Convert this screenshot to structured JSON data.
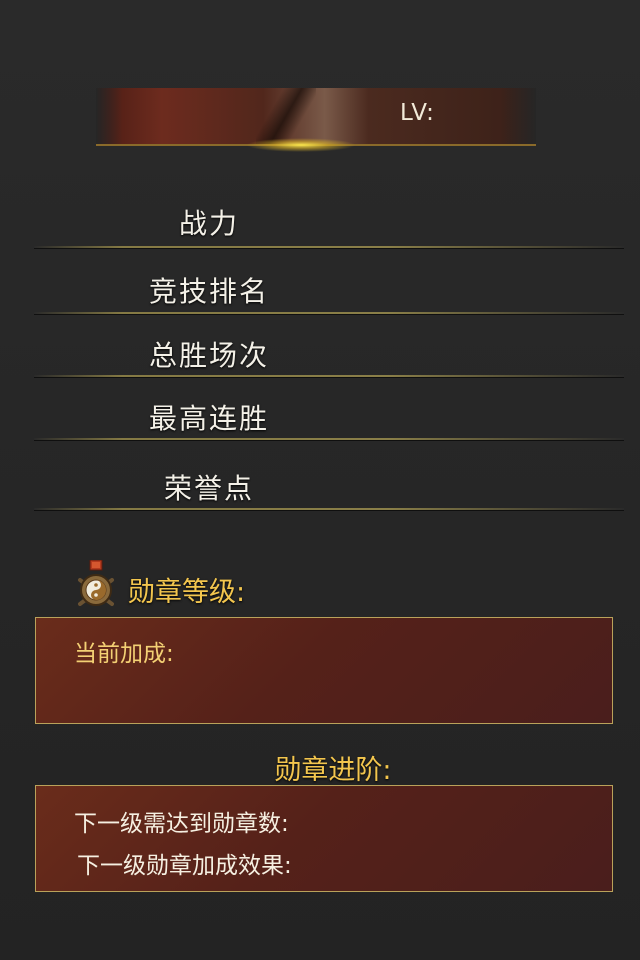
{
  "header": {
    "level_label": "LV:"
  },
  "stats": {
    "combat_power": "战力",
    "arena_rank": "竞技排名",
    "total_wins": "总胜场次",
    "best_streak": "最高连胜",
    "honor_points": "荣誉点"
  },
  "medal": {
    "icon": "taiji-medal-icon",
    "level_title": "勋章等级:",
    "current_bonus_label": "当前加成:"
  },
  "advance": {
    "title": "勋章进阶:",
    "next_level_required": "下一级需达到勋章数:",
    "next_level_bonus": "下一级勋章加成效果:"
  },
  "colors": {
    "background": "#262626",
    "gold_text": "#f3c64e",
    "panel_border": "#b9a25a",
    "panel_fill": "#552119",
    "divider": "#857a44"
  }
}
